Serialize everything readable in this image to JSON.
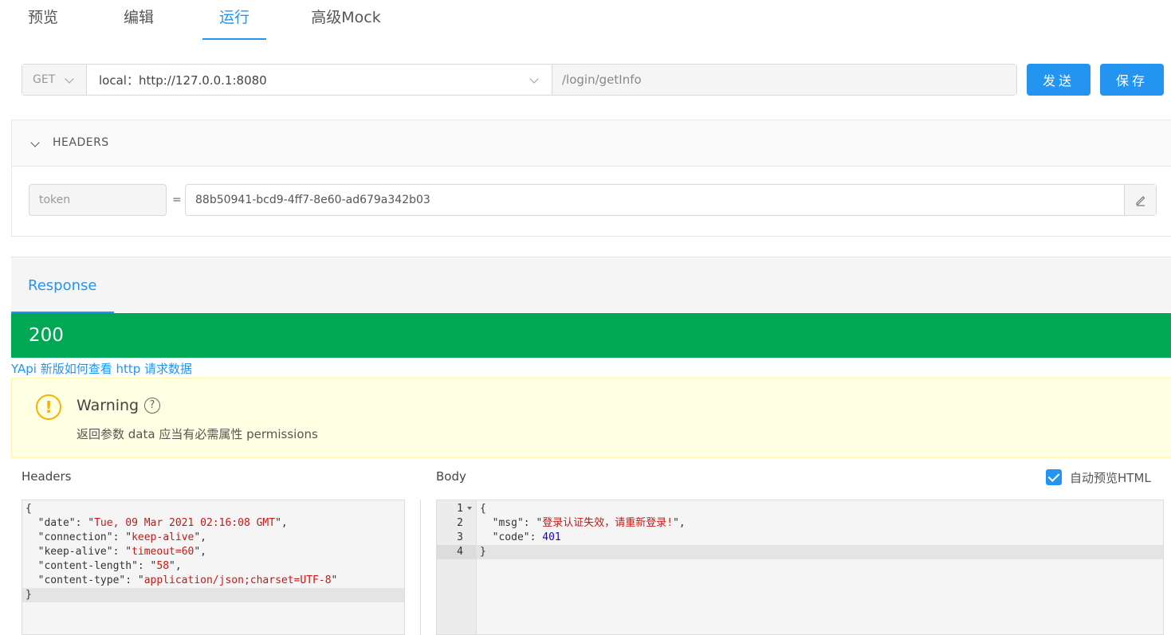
{
  "tabs": [
    "预览",
    "编辑",
    "运行",
    "高级Mock"
  ],
  "active_tab": "运行",
  "request": {
    "method": "GET",
    "env": "local：http://127.0.0.1:8080",
    "path": "/login/getInfo",
    "send_label": "发送",
    "save_label": "保存"
  },
  "headers_panel": {
    "title": "HEADERS",
    "key": "token",
    "eq": "=",
    "value": "88b50941-bcd9-4ff7-8e60-ad679a342b03"
  },
  "response": {
    "tab_label": "Response",
    "status": "200",
    "doc_link": "YApi 新版如何查看 http 请求数据",
    "warning_title": "Warning",
    "warning_message": "返回参数 data 应当有必需属性 permissions",
    "headers_label": "Headers",
    "body_label": "Body",
    "auto_preview_label": "自动预览HTML",
    "auto_preview_checked": true
  },
  "response_headers": [
    {
      "key": "date",
      "value": "Tue, 09 Mar 2021 02:16:08 GMT"
    },
    {
      "key": "connection",
      "value": "keep-alive"
    },
    {
      "key": "keep-alive",
      "value": "timeout=60"
    },
    {
      "key": "content-length",
      "value": "58"
    },
    {
      "key": "content-type",
      "value": "application/json;charset=UTF-8"
    }
  ],
  "response_body": {
    "line_numbers": [
      "1",
      "2",
      "3",
      "4"
    ],
    "msg_key": "msg",
    "msg_value": "登录认证失效，请重新登录!",
    "code_key": "code",
    "code_value": "401"
  },
  "colors": {
    "accent": "#2395f1",
    "success": "#00a854",
    "warning_bg": "#ffffe4",
    "warning_icon": "#f5b400"
  }
}
